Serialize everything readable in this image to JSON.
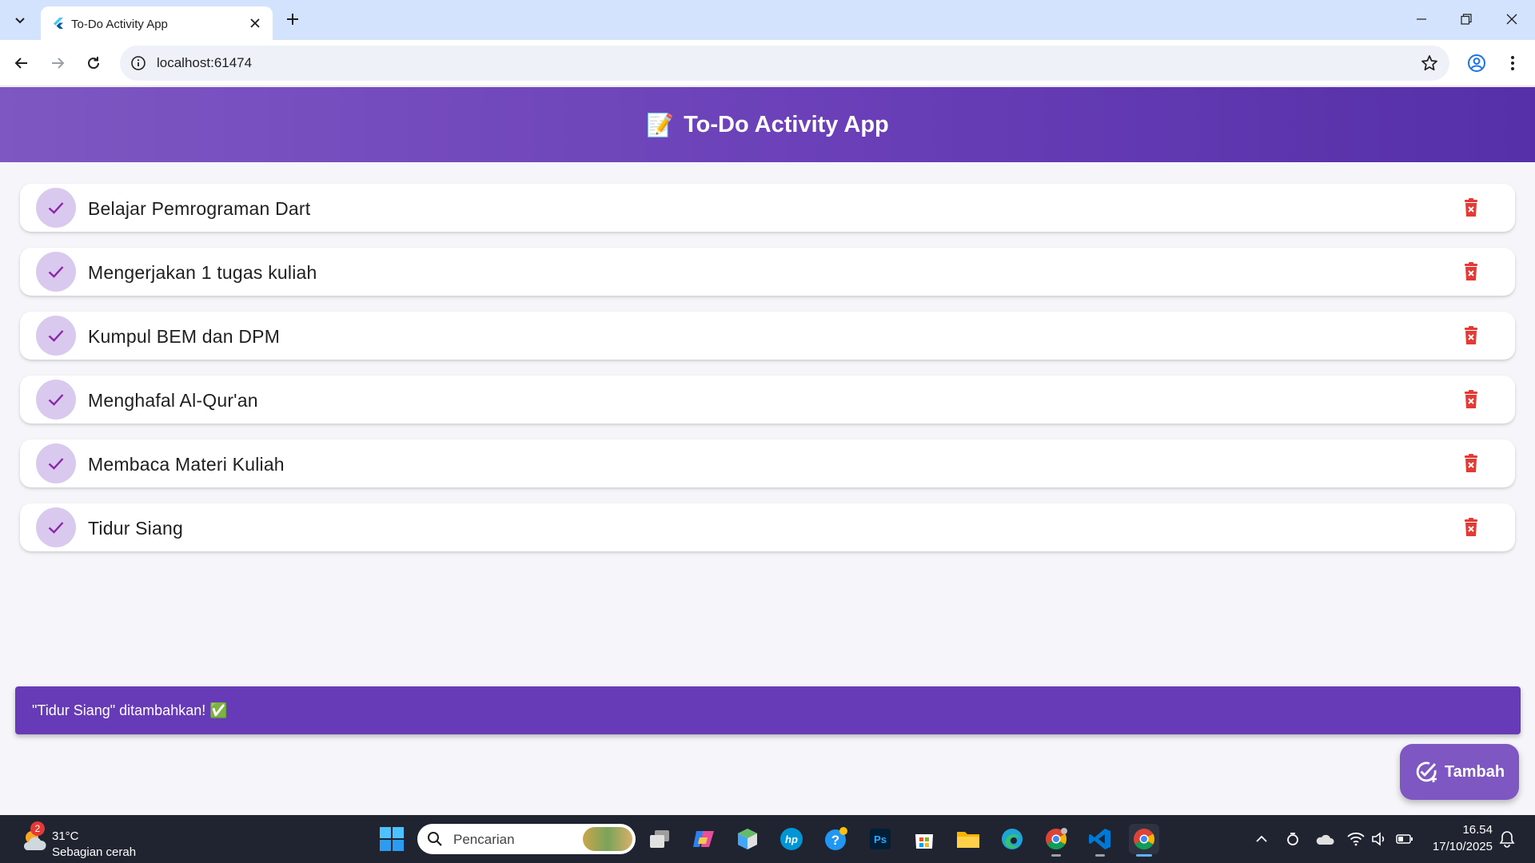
{
  "browser": {
    "tab_title": "To-Do Activity App",
    "url": "localhost:61474"
  },
  "app": {
    "emoji": "📝",
    "title": "To-Do Activity App",
    "accent_color": "#673ab7",
    "delete_color": "#e53935",
    "tasks": [
      {
        "title": "Belajar Pemrograman Dart",
        "done": true
      },
      {
        "title": "Mengerjakan 1 tugas kuliah",
        "done": true
      },
      {
        "title": "Kumpul BEM dan DPM",
        "done": true
      },
      {
        "title": "Menghafal Al-Qur'an",
        "done": true
      },
      {
        "title": "Membaca Materi Kuliah",
        "done": true
      },
      {
        "title": "Tidur Siang",
        "done": true
      }
    ],
    "snackbar": "\"Tidur Siang\" ditambahkan! ✅",
    "fab_label": "Tambah"
  },
  "taskbar": {
    "weather_badge": "2",
    "weather_temp": "31°C",
    "weather_desc": "Sebagian cerah",
    "search_placeholder": "Pencarian",
    "clock_time": "16.54",
    "clock_date": "17/10/2025",
    "pinned_apps": [
      "task-view",
      "copilot",
      "hp-app-box",
      "hp-smart",
      "get-help",
      "photoshop",
      "microsoft-store",
      "file-explorer",
      "edge",
      "chrome-profile",
      "vscode",
      "chrome"
    ]
  }
}
